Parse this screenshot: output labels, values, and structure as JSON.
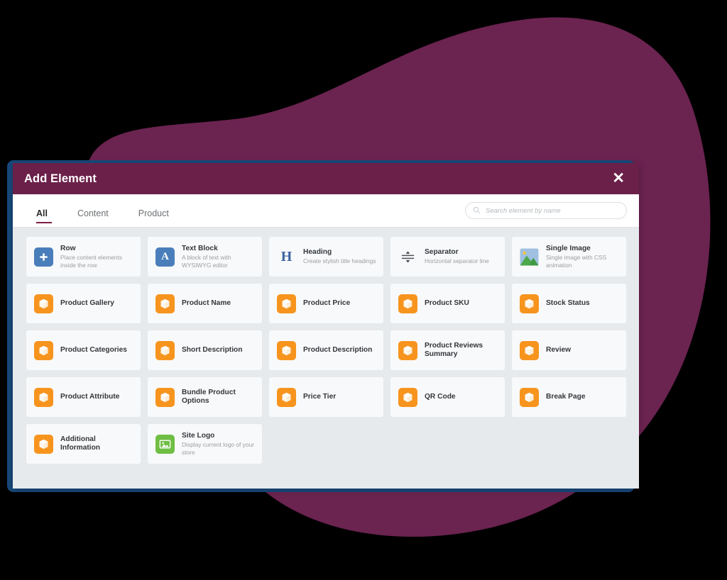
{
  "window": {
    "title": "Add Element",
    "close_icon": "close-icon",
    "close_label": "✕"
  },
  "toolbar": {
    "tabs": [
      {
        "label": "All",
        "active": true
      },
      {
        "label": "Content",
        "active": false
      },
      {
        "label": "Product",
        "active": false
      }
    ],
    "search": {
      "placeholder": "Search element by name",
      "value": "",
      "icon": "search-icon"
    }
  },
  "colors": {
    "header_bg": "#6b2049",
    "blob": "#6b2350",
    "frame_border": "#184a7d",
    "body_bg": "#e7eaec",
    "card_bg": "#f8f9fa",
    "accent_underline": "#7b1f47",
    "icon_blue": "#4a7ebb",
    "icon_orange": "#f7941e",
    "icon_green": "#6fbe44",
    "heading_letter": "#3c64a0",
    "page_bg": "#000000"
  },
  "elements": [
    {
      "title": "Row",
      "desc": "Place content elements inside the row",
      "icon": "plus-square-icon",
      "icon_style": "blue"
    },
    {
      "title": "Text Block",
      "desc": "A block of text with WYSIWYG editor",
      "icon": "letter-a-icon",
      "icon_style": "blue"
    },
    {
      "title": "Heading",
      "desc": "Create stylish title headings",
      "icon": "letter-h-icon",
      "icon_style": "plain"
    },
    {
      "title": "Separator",
      "desc": "Horizontal separator line",
      "icon": "separator-icon",
      "icon_style": "plain"
    },
    {
      "title": "Single Image",
      "desc": "Single image with CSS animation",
      "icon": "image-icon",
      "icon_style": "image"
    },
    {
      "title": "Product Gallery",
      "desc": "",
      "icon": "box-icon",
      "icon_style": "orange"
    },
    {
      "title": "Product Name",
      "desc": "",
      "icon": "box-icon",
      "icon_style": "orange"
    },
    {
      "title": "Product Price",
      "desc": "",
      "icon": "box-icon",
      "icon_style": "orange"
    },
    {
      "title": "Product SKU",
      "desc": "",
      "icon": "box-icon",
      "icon_style": "orange"
    },
    {
      "title": "Stock Status",
      "desc": "",
      "icon": "box-icon",
      "icon_style": "orange"
    },
    {
      "title": "Product Categories",
      "desc": "",
      "icon": "box-icon",
      "icon_style": "orange"
    },
    {
      "title": "Short Description",
      "desc": "",
      "icon": "box-icon",
      "icon_style": "orange"
    },
    {
      "title": "Product Description",
      "desc": "",
      "icon": "box-icon",
      "icon_style": "orange"
    },
    {
      "title": "Product Reviews Summary",
      "desc": "",
      "icon": "box-icon",
      "icon_style": "orange"
    },
    {
      "title": "Review",
      "desc": "",
      "icon": "box-icon",
      "icon_style": "orange"
    },
    {
      "title": "Product Attribute",
      "desc": "",
      "icon": "box-icon",
      "icon_style": "orange"
    },
    {
      "title": "Bundle Product Options",
      "desc": "",
      "icon": "box-icon",
      "icon_style": "orange"
    },
    {
      "title": "Price Tier",
      "desc": "",
      "icon": "box-icon",
      "icon_style": "orange"
    },
    {
      "title": "QR Code",
      "desc": "",
      "icon": "box-icon",
      "icon_style": "orange"
    },
    {
      "title": "Break Page",
      "desc": "",
      "icon": "box-icon",
      "icon_style": "orange"
    },
    {
      "title": "Additional Information",
      "desc": "",
      "icon": "box-icon",
      "icon_style": "orange"
    },
    {
      "title": "Site Logo",
      "desc": "Display current logo of your store",
      "icon": "image-frame-icon",
      "icon_style": "green"
    }
  ]
}
